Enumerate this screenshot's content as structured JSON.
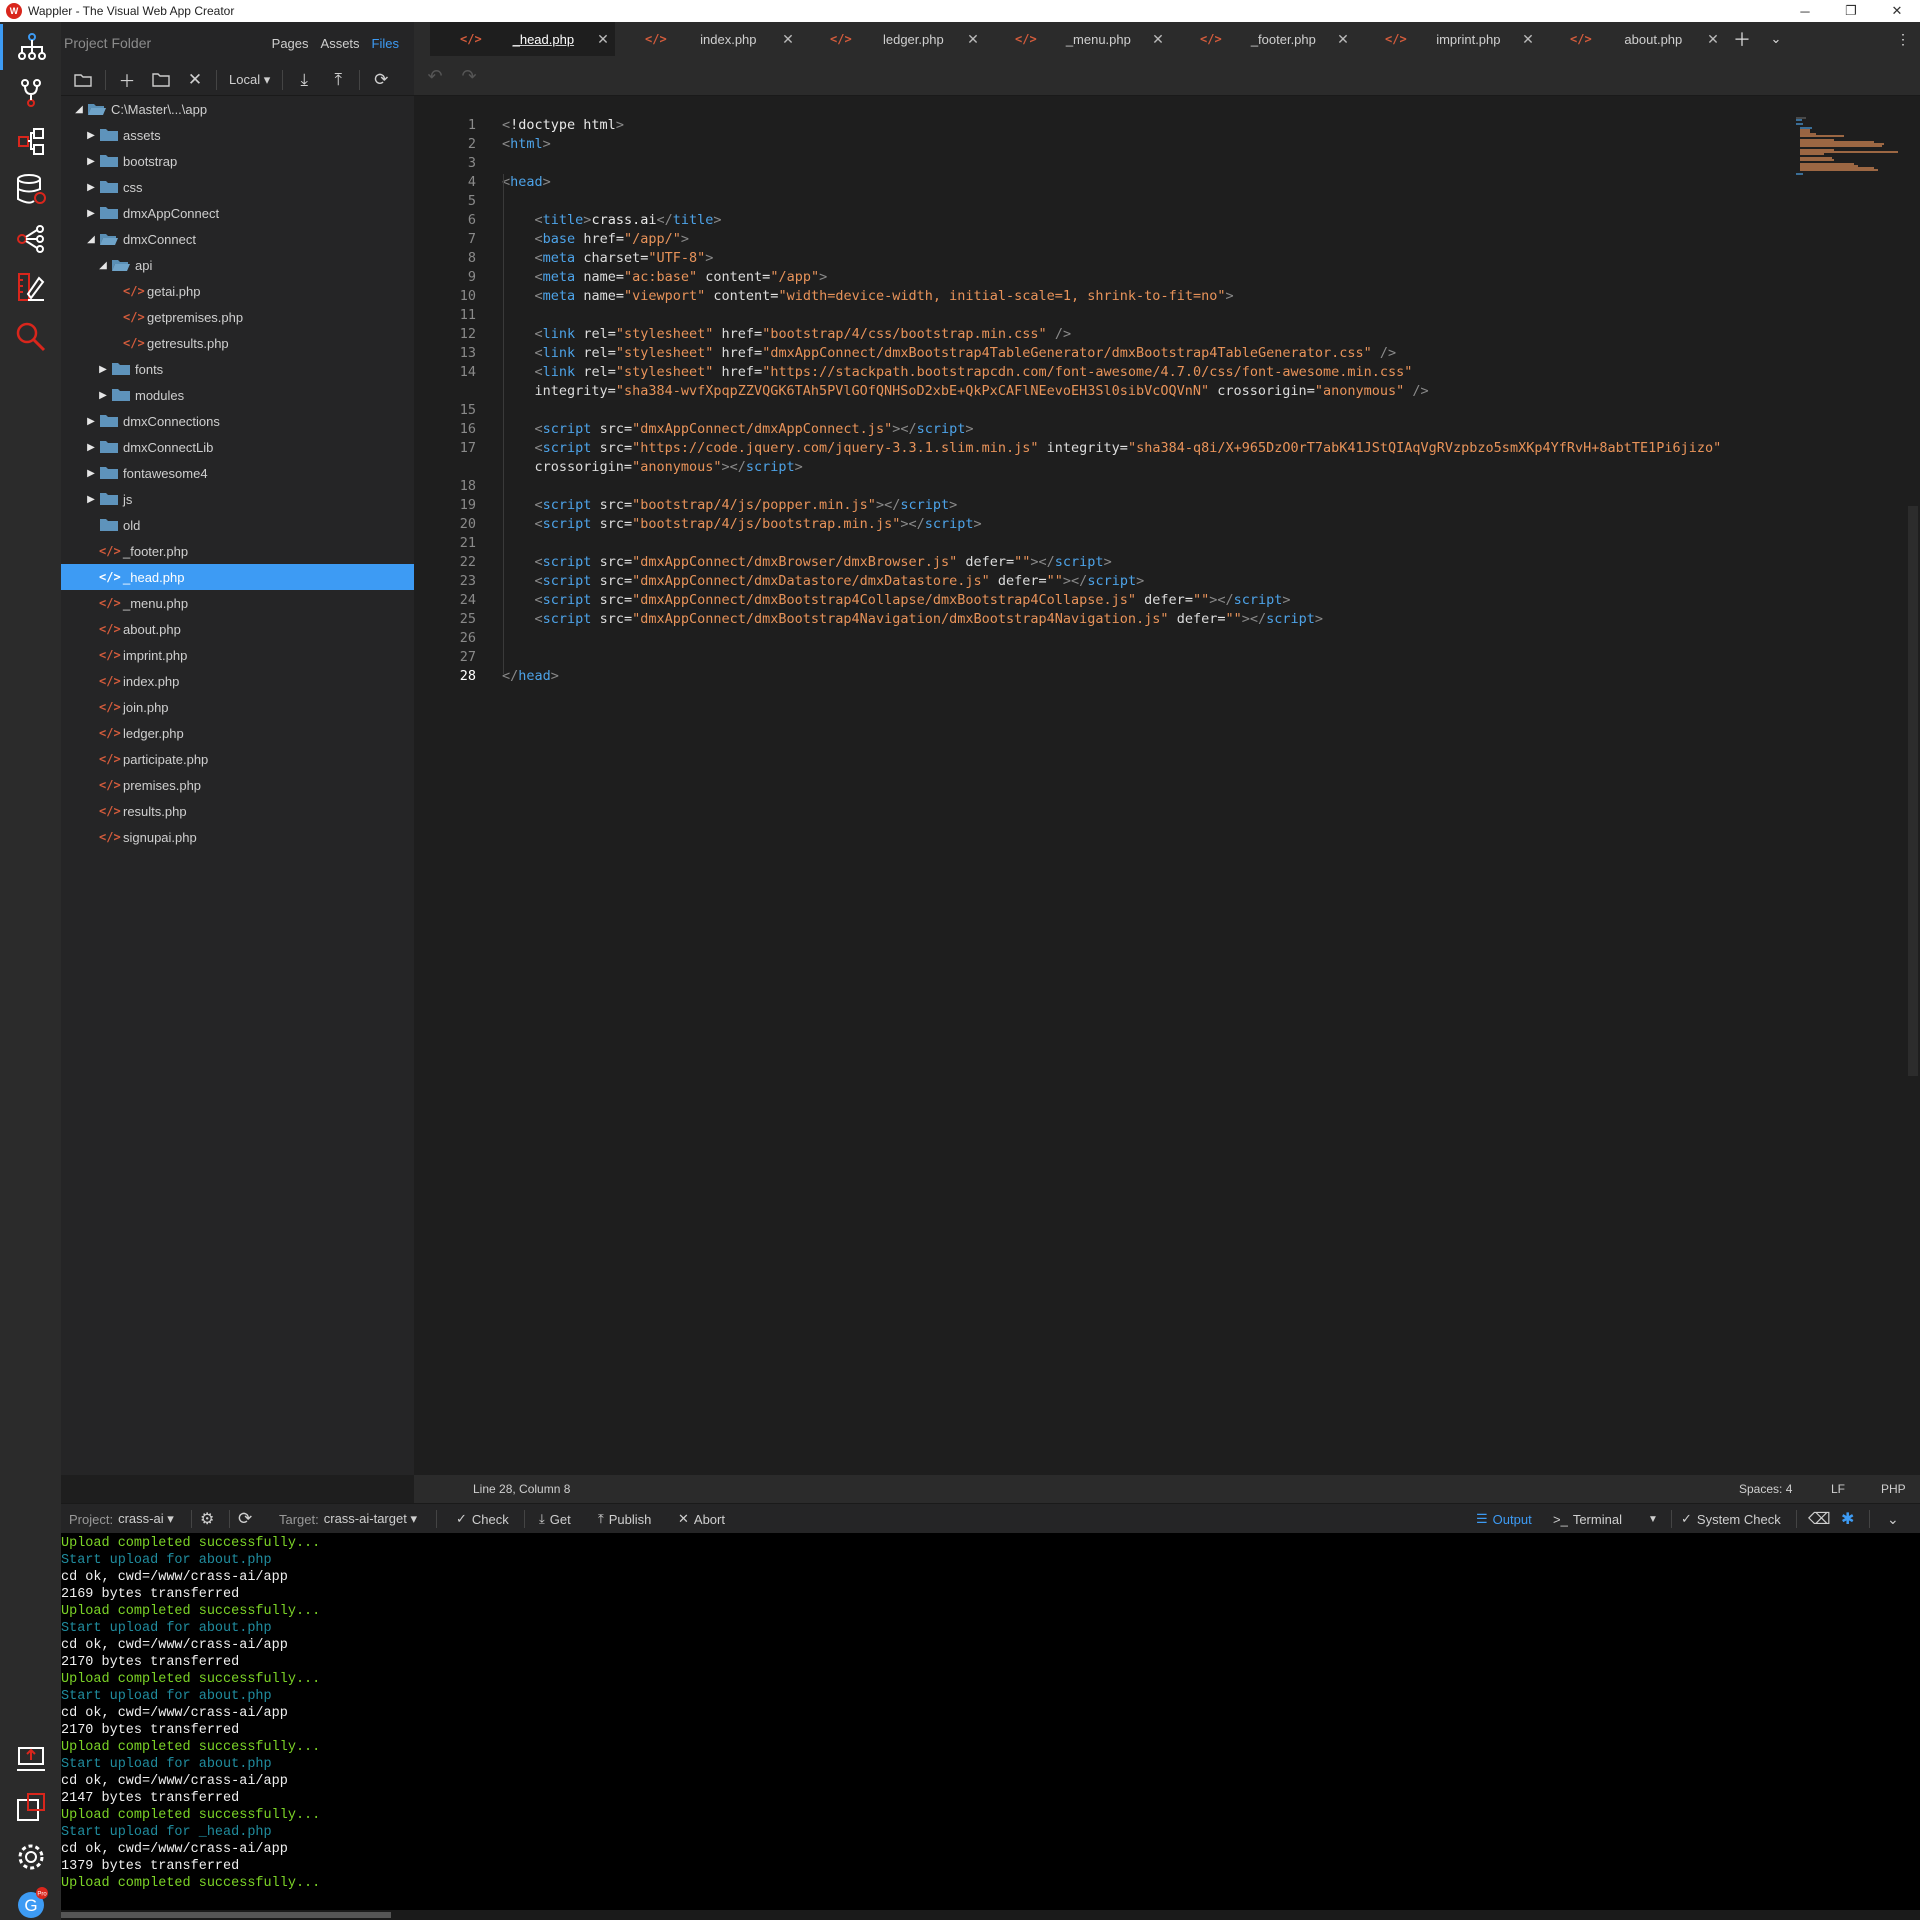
{
  "window": {
    "title": "Wappler - The Visual Web App Creator",
    "logo_text": "W",
    "minimize": "─",
    "maximize": "❐",
    "close": "✕"
  },
  "activity": [
    {
      "name": "app-structure-icon",
      "active": true
    },
    {
      "name": "git-icon"
    },
    {
      "name": "workflow-icon"
    },
    {
      "name": "database-icon"
    },
    {
      "name": "resources-icon"
    },
    {
      "name": "design-icon"
    },
    {
      "name": "search-icon"
    },
    {
      "name": "publish-icon"
    },
    {
      "name": "plugin-icon"
    },
    {
      "name": "settings-icon"
    },
    {
      "name": "user-avatar-icon"
    }
  ],
  "avatar": {
    "letter": "G",
    "badge": "Pro"
  },
  "sidebar": {
    "title": "Project Folder",
    "tabs": [
      "Pages",
      "Assets",
      "Files"
    ],
    "active_tab": "Files",
    "target_dropdown": "Local ▾"
  },
  "tree": [
    {
      "label": "C:\\Master\\...\\app",
      "type": "folder",
      "depth": 0,
      "open": true
    },
    {
      "label": "assets",
      "type": "folder",
      "depth": 1
    },
    {
      "label": "bootstrap",
      "type": "folder",
      "depth": 1
    },
    {
      "label": "css",
      "type": "folder",
      "depth": 1
    },
    {
      "label": "dmxAppConnect",
      "type": "folder",
      "depth": 1
    },
    {
      "label": "dmxConnect",
      "type": "folder",
      "depth": 1,
      "open": true
    },
    {
      "label": "api",
      "type": "folder",
      "depth": 2,
      "open": true
    },
    {
      "label": "getai.php",
      "type": "php",
      "depth": 3
    },
    {
      "label": "getpremises.php",
      "type": "php",
      "depth": 3
    },
    {
      "label": "getresults.php",
      "type": "php",
      "depth": 3
    },
    {
      "label": "fonts",
      "type": "folder",
      "depth": 2
    },
    {
      "label": "modules",
      "type": "folder",
      "depth": 2
    },
    {
      "label": "dmxConnections",
      "type": "folder",
      "depth": 1
    },
    {
      "label": "dmxConnectLib",
      "type": "folder",
      "depth": 1
    },
    {
      "label": "fontawesome4",
      "type": "folder",
      "depth": 1
    },
    {
      "label": "js",
      "type": "folder",
      "depth": 1
    },
    {
      "label": "old",
      "type": "folder",
      "depth": 1,
      "empty": true
    },
    {
      "label": "_footer.php",
      "type": "php",
      "depth": 1
    },
    {
      "label": "_head.php",
      "type": "php",
      "depth": 1,
      "selected": true
    },
    {
      "label": "_menu.php",
      "type": "php",
      "depth": 1
    },
    {
      "label": "about.php",
      "type": "php",
      "depth": 1
    },
    {
      "label": "imprint.php",
      "type": "php",
      "depth": 1
    },
    {
      "label": "index.php",
      "type": "php",
      "depth": 1
    },
    {
      "label": "join.php",
      "type": "php",
      "depth": 1
    },
    {
      "label": "ledger.php",
      "type": "php",
      "depth": 1
    },
    {
      "label": "participate.php",
      "type": "php",
      "depth": 1
    },
    {
      "label": "premises.php",
      "type": "php",
      "depth": 1
    },
    {
      "label": "results.php",
      "type": "php",
      "depth": 1
    },
    {
      "label": "signupai.php",
      "type": "php",
      "depth": 1
    }
  ],
  "tabs": [
    {
      "label": "_head.php",
      "active": true
    },
    {
      "label": "index.php"
    },
    {
      "label": "ledger.php"
    },
    {
      "label": "_menu.php"
    },
    {
      "label": "_footer.php"
    },
    {
      "label": "imprint.php"
    },
    {
      "label": "about.php"
    }
  ],
  "code_lines": [
    {
      "n": "1",
      "html": "<span class='ang'>&lt;</span><span class='kw'>!doctype html</span><span class='ang'>&gt;</span>"
    },
    {
      "n": "2",
      "html": "<span class='ang'>&lt;</span><span class='tag'>html</span><span class='ang'>&gt;</span>"
    },
    {
      "n": "3",
      "html": ""
    },
    {
      "n": "4",
      "html": "<span class='ang'>&lt;</span><span class='tag'>head</span><span class='ang'>&gt;</span>"
    },
    {
      "n": "5",
      "html": ""
    },
    {
      "n": "6",
      "html": "    <span class='ang'>&lt;</span><span class='tag'>title</span><span class='ang'>&gt;</span><span class='txt'>crass.ai</span><span class='ang'>&lt;/</span><span class='tag'>title</span><span class='ang'>&gt;</span>"
    },
    {
      "n": "7",
      "html": "    <span class='ang'>&lt;</span><span class='tag'>base</span> <span class='an'>href</span>=<span class='av'>\"/app/\"</span><span class='ang'>&gt;</span>"
    },
    {
      "n": "8",
      "html": "    <span class='ang'>&lt;</span><span class='tag'>meta</span> <span class='an'>charset</span>=<span class='av'>\"UTF-8\"</span><span class='ang'>&gt;</span>"
    },
    {
      "n": "9",
      "html": "    <span class='ang'>&lt;</span><span class='tag'>meta</span> <span class='an'>name</span>=<span class='av'>\"ac:base\"</span> <span class='an'>content</span>=<span class='av'>\"/app\"</span><span class='ang'>&gt;</span>"
    },
    {
      "n": "10",
      "html": "    <span class='ang'>&lt;</span><span class='tag'>meta</span> <span class='an'>name</span>=<span class='av'>\"viewport\"</span> <span class='an'>content</span>=<span class='av'>\"width=device-width, initial-scale=1, shrink-to-fit=no\"</span><span class='ang'>&gt;</span>"
    },
    {
      "n": "11",
      "html": ""
    },
    {
      "n": "12",
      "html": "    <span class='ang'>&lt;</span><span class='tag'>link</span> <span class='an'>rel</span>=<span class='av'>\"stylesheet\"</span> <span class='an'>href</span>=<span class='av'>\"bootstrap/4/css/bootstrap.min.css\"</span> <span class='ang'>/&gt;</span>"
    },
    {
      "n": "13",
      "html": "    <span class='ang'>&lt;</span><span class='tag'>link</span> <span class='an'>rel</span>=<span class='av'>\"stylesheet\"</span> <span class='an'>href</span>=<span class='av'>\"dmxAppConnect/dmxBootstrap4TableGenerator/dmxBootstrap4TableGenerator.css\"</span> <span class='ang'>/&gt;</span>"
    },
    {
      "n": "14",
      "html": "    <span class='ang'>&lt;</span><span class='tag'>link</span> <span class='an'>rel</span>=<span class='av'>\"stylesheet\"</span> <span class='an'>href</span>=<span class='av'>\"https://stackpath.bootstrapcdn.com/font-awesome/4.7.0/css/font-awesome.min.css\"</span>"
    },
    {
      "n": "",
      "html": "    <span class='an'>integrity</span>=<span class='av'>\"sha384-wvfXpqpZZVQGK6TAh5PVlGOfQNHSoD2xbE+QkPxCAFlNEevoEH3Sl0sibVcOQVnN\"</span> <span class='an'>crossorigin</span>=<span class='av'>\"anonymous\"</span> <span class='ang'>/&gt;</span>"
    },
    {
      "n": "15",
      "html": ""
    },
    {
      "n": "16",
      "html": "    <span class='ang'>&lt;</span><span class='tag'>script</span> <span class='an'>src</span>=<span class='av'>\"dmxAppConnect/dmxAppConnect.js\"</span><span class='ang'>&gt;&lt;/</span><span class='tag'>script</span><span class='ang'>&gt;</span>"
    },
    {
      "n": "17",
      "html": "    <span class='ang'>&lt;</span><span class='tag'>script</span> <span class='an'>src</span>=<span class='av'>\"https://code.jquery.com/jquery-3.3.1.slim.min.js\"</span> <span class='an'>integrity</span>=<span class='av'>\"sha384-q8i/X+965DzO0rT7abK41JStQIAqVgRVzpbzo5smXKp4YfRvH+8abtTE1Pi6jizo\"</span>"
    },
    {
      "n": "",
      "html": "    <span class='an'>crossorigin</span>=<span class='av'>\"anonymous\"</span><span class='ang'>&gt;&lt;/</span><span class='tag'>script</span><span class='ang'>&gt;</span>"
    },
    {
      "n": "18",
      "html": ""
    },
    {
      "n": "19",
      "html": "    <span class='ang'>&lt;</span><span class='tag'>script</span> <span class='an'>src</span>=<span class='av'>\"bootstrap/4/js/popper.min.js\"</span><span class='ang'>&gt;&lt;/</span><span class='tag'>script</span><span class='ang'>&gt;</span>"
    },
    {
      "n": "20",
      "html": "    <span class='ang'>&lt;</span><span class='tag'>script</span> <span class='an'>src</span>=<span class='av'>\"bootstrap/4/js/bootstrap.min.js\"</span><span class='ang'>&gt;&lt;/</span><span class='tag'>script</span><span class='ang'>&gt;</span>"
    },
    {
      "n": "21",
      "html": ""
    },
    {
      "n": "22",
      "html": "    <span class='ang'>&lt;</span><span class='tag'>script</span> <span class='an'>src</span>=<span class='av'>\"dmxAppConnect/dmxBrowser/dmxBrowser.js\"</span> <span class='an'>defer</span>=<span class='av'>\"\"</span><span class='ang'>&gt;&lt;/</span><span class='tag'>script</span><span class='ang'>&gt;</span>"
    },
    {
      "n": "23",
      "html": "    <span class='ang'>&lt;</span><span class='tag'>script</span> <span class='an'>src</span>=<span class='av'>\"dmxAppConnect/dmxDatastore/dmxDatastore.js\"</span> <span class='an'>defer</span>=<span class='av'>\"\"</span><span class='ang'>&gt;&lt;/</span><span class='tag'>script</span><span class='ang'>&gt;</span>"
    },
    {
      "n": "24",
      "html": "    <span class='ang'>&lt;</span><span class='tag'>script</span> <span class='an'>src</span>=<span class='av'>\"dmxAppConnect/dmxBootstrap4Collapse/dmxBootstrap4Collapse.js\"</span> <span class='an'>defer</span>=<span class='av'>\"\"</span><span class='ang'>&gt;&lt;/</span><span class='tag'>script</span><span class='ang'>&gt;</span>"
    },
    {
      "n": "25",
      "html": "    <span class='ang'>&lt;</span><span class='tag'>script</span> <span class='an'>src</span>=<span class='av'>\"dmxAppConnect/dmxBootstrap4Navigation/dmxBootstrap4Navigation.js\"</span> <span class='an'>defer</span>=<span class='av'>\"\"</span><span class='ang'>&gt;&lt;/</span><span class='tag'>script</span><span class='ang'>&gt;</span>"
    },
    {
      "n": "26",
      "html": ""
    },
    {
      "n": "27",
      "html": ""
    },
    {
      "n": "28",
      "html": "<span class='ang'>&lt;/</span><span class='tag'>head</span><span class='ang'>&gt;</span>",
      "current": true
    }
  ],
  "status": {
    "position": "Line 28, Column 8",
    "spaces": "Spaces: 4",
    "eol": "LF",
    "language": "PHP"
  },
  "panel": {
    "project_label": "Project:",
    "project_value": "crass-ai ▾",
    "target_label": "Target:",
    "target_value": "crass-ai-target ▾",
    "check": "Check",
    "get": "Get",
    "publish": "Publish",
    "abort": "Abort",
    "output": "Output",
    "terminal": "Terminal",
    "system_check": "System Check"
  },
  "console": [
    {
      "kind": "ok",
      "text": "Upload completed successfully..."
    },
    {
      "kind": "start",
      "text": "Start upload for about.php"
    },
    {
      "kind": "info",
      "text": "cd ok, cwd=/www/crass-ai/app"
    },
    {
      "kind": "info",
      "text": "2169 bytes transferred"
    },
    {
      "kind": "ok",
      "text": "Upload completed successfully..."
    },
    {
      "kind": "start",
      "text": "Start upload for about.php"
    },
    {
      "kind": "info",
      "text": "cd ok, cwd=/www/crass-ai/app"
    },
    {
      "kind": "info",
      "text": "2170 bytes transferred"
    },
    {
      "kind": "ok",
      "text": "Upload completed successfully..."
    },
    {
      "kind": "start",
      "text": "Start upload for about.php"
    },
    {
      "kind": "info",
      "text": "cd ok, cwd=/www/crass-ai/app"
    },
    {
      "kind": "info",
      "text": "2170 bytes transferred"
    },
    {
      "kind": "ok",
      "text": "Upload completed successfully..."
    },
    {
      "kind": "start",
      "text": "Start upload for about.php"
    },
    {
      "kind": "info",
      "text": "cd ok, cwd=/www/crass-ai/app"
    },
    {
      "kind": "info",
      "text": "2147 bytes transferred"
    },
    {
      "kind": "ok",
      "text": "Upload completed successfully..."
    },
    {
      "kind": "start",
      "text": "Start upload for _head.php"
    },
    {
      "kind": "info",
      "text": "cd ok, cwd=/www/crass-ai/app"
    },
    {
      "kind": "info",
      "text": "1379 bytes transferred"
    },
    {
      "kind": "ok",
      "text": "Upload completed successfully..."
    }
  ],
  "colors": {
    "accent": "#3d9bf4",
    "php_icon": "#d45c3c",
    "brand": "#d9261c"
  }
}
